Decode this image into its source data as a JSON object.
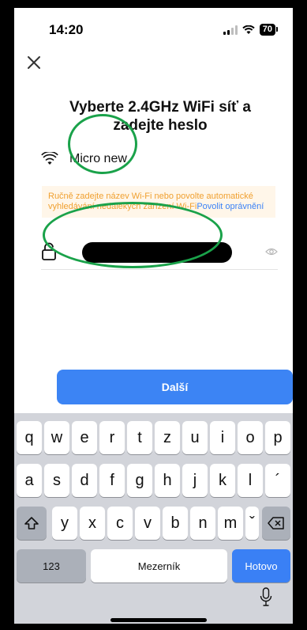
{
  "status_bar": {
    "time": "14:20",
    "battery": "70"
  },
  "page": {
    "title_line1": "Vyberte 2.4GHz WiFi síť a",
    "title_line2": "zadejte heslo",
    "ssid": "Micro new",
    "warning_text": "Ručně zadejte název Wi-Fi nebo povolte automatické vyhledávání nedalekých zařízení Wi-Fi",
    "warning_link": "Povolit oprávnění",
    "next_label": "Další"
  },
  "keyboard": {
    "row1": [
      "q",
      "w",
      "e",
      "r",
      "t",
      "z",
      "u",
      "i",
      "o",
      "p"
    ],
    "row2": [
      "a",
      "s",
      "d",
      "f",
      "g",
      "h",
      "j",
      "k",
      "l",
      "´"
    ],
    "row3": [
      "y",
      "x",
      "c",
      "v",
      "b",
      "n",
      "m",
      "ˇ"
    ],
    "numbers_label": "123",
    "space_label": "Mezerník",
    "done_label": "Hotovo"
  },
  "colors": {
    "accent": "#3c84f4",
    "warning_bg": "#fff6e9",
    "warning_text": "#f0a030",
    "annotation": "#1aa24a"
  }
}
